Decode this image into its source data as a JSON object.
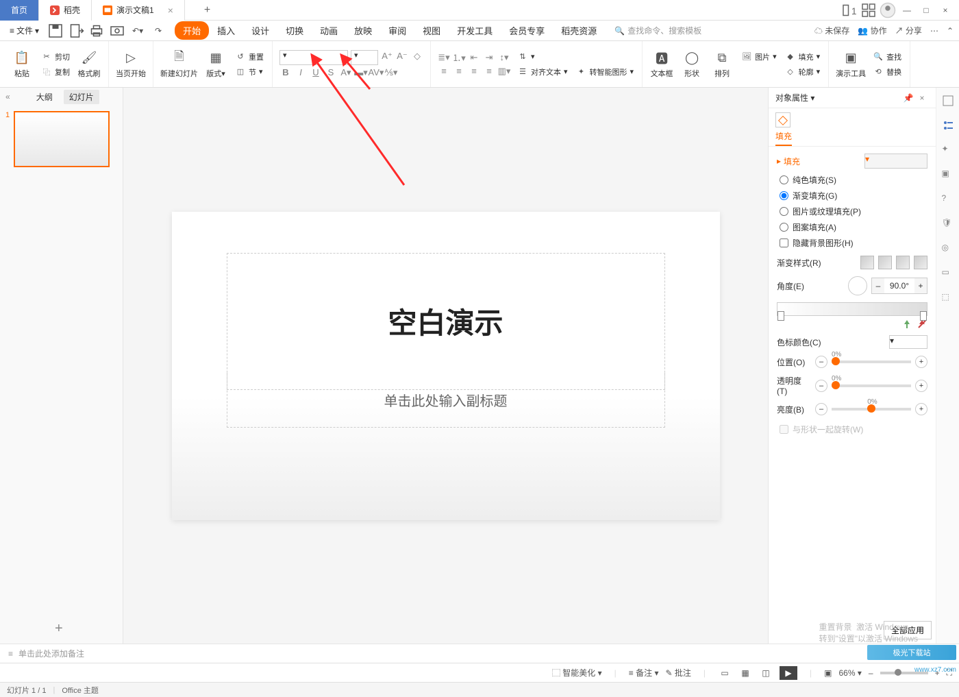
{
  "titlebar": {
    "tabs": {
      "home": "首页",
      "daoke": "稻壳",
      "doc": "演示文稿1"
    }
  },
  "menubar": {
    "file": "文件",
    "tabs": [
      "开始",
      "插入",
      "设计",
      "切换",
      "动画",
      "放映",
      "审阅",
      "视图",
      "开发工具",
      "会员专享",
      "稻壳资源"
    ],
    "search_placeholder": "查找命令、搜索模板",
    "unsaved": "未保存",
    "collab": "协作",
    "share": "分享"
  },
  "ribbon": {
    "cut": "剪切",
    "copy": "复制",
    "paste": "粘贴",
    "format_painter": "格式刷",
    "from_current": "当页开始",
    "new_slide": "新建幻灯片",
    "layout": "版式",
    "reset": "重置",
    "section": "节",
    "align_text": "对齐文本",
    "smart_shape": "转智能图形",
    "text_box": "文本框",
    "shape": "形状",
    "arrange": "排列",
    "picture": "图片",
    "fill": "填充",
    "outline": "轮廓",
    "present_tool": "演示工具",
    "find": "查找",
    "replace": "替换"
  },
  "sidebar_left": {
    "outline": "大纲",
    "slides": "幻灯片",
    "slide_num": "1"
  },
  "slide": {
    "title": "空白演示",
    "subtitle": "单击此处输入副标题"
  },
  "notes": {
    "placeholder": "单击此处添加备注"
  },
  "panel": {
    "title": "对象属性",
    "tab_fill": "填充",
    "section_fill": "填充",
    "solid": "纯色填充(S)",
    "gradient": "渐变填充(G)",
    "picture": "图片或纹理填充(P)",
    "pattern": "图案填充(A)",
    "hide_bg": "隐藏背景图形(H)",
    "grad_style": "渐变样式(R)",
    "angle": "角度(E)",
    "angle_val": "90.0°",
    "stop_color": "色标颜色(C)",
    "position": "位置(O)",
    "transparency": "透明度(T)",
    "brightness": "亮度(B)",
    "rotate_with": "与形状一起旋转(W)",
    "pct": "0%"
  },
  "apply_all": "全部应用",
  "activate": {
    "line1": "激活 Windows",
    "line2": "转到\"设置\"以激活 Windows",
    "alt": "重置背景"
  },
  "statusbar": {
    "beautify": "智能美化",
    "notes": "备注",
    "comments": "批注",
    "zoom": "66%"
  },
  "bottombar": {
    "slide": "幻灯片 1 / 1",
    "theme": "Office 主题"
  },
  "watermark": {
    "brand": "极光下载站",
    "url": "www.xz7.com"
  }
}
